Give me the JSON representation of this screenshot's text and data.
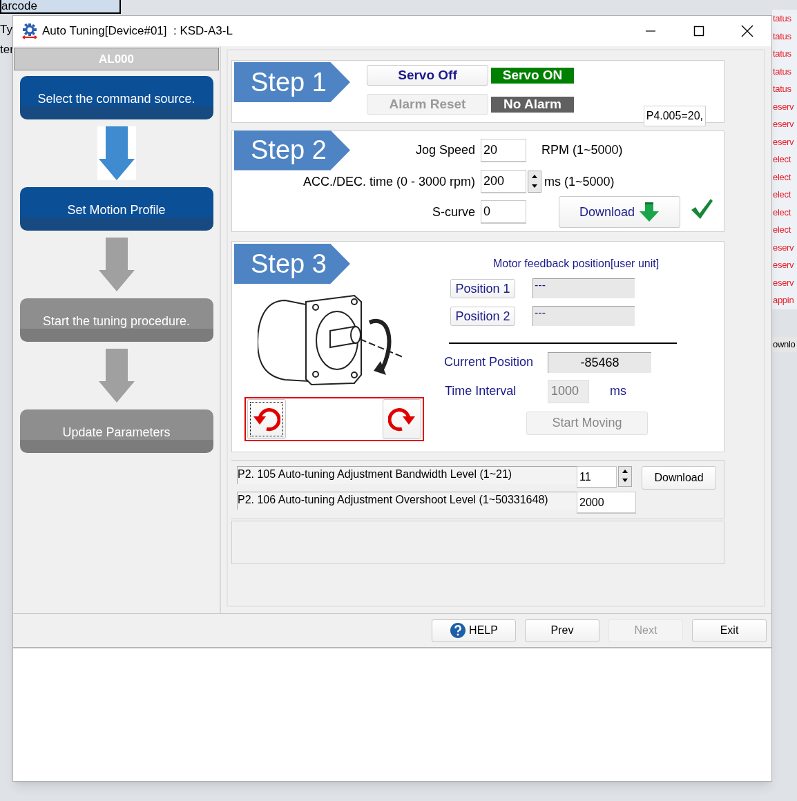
{
  "background_app": {
    "left_labels": [
      "arcode",
      "Ty",
      "ter"
    ],
    "right_column": [
      "tatus",
      "tatus",
      "tatus",
      "tatus",
      "tatus",
      "eserv",
      "eserv",
      "eserv",
      "elect",
      "elect",
      "elect",
      "elect",
      "elect",
      "eserv",
      "eserv",
      "eserv",
      "appin"
    ],
    "right_bottom": "ownlo"
  },
  "window": {
    "title": "Auto Tuning[Device#01]  : KSD-A3-L"
  },
  "alarm_code": "AL000",
  "steps": [
    {
      "label": "Select the command source.",
      "active": true
    },
    {
      "label": "Set Motion Profile",
      "active": true
    },
    {
      "label": "Start the tuning procedure.",
      "active": false
    },
    {
      "label": "Update Parameters",
      "active": false
    }
  ],
  "step1": {
    "badge": "Step 1",
    "buttons": [
      {
        "label": "Servo Off",
        "disabled": false
      },
      {
        "label": "Alarm Reset",
        "disabled": true
      }
    ],
    "indicators": [
      {
        "label": "Servo ON",
        "color": "#008000"
      },
      {
        "label": "No Alarm",
        "color": "#606060"
      }
    ],
    "param_field": "P4.005=20,"
  },
  "step2": {
    "badge": "Step 2",
    "fields": [
      {
        "label": "Jog Speed",
        "value": "20",
        "unit": "RPM (1~5000)",
        "spinner": false
      },
      {
        "label": "ACC./DEC. time (0 - 3000 rpm)",
        "value": "200",
        "unit": "ms (1~5000)",
        "spinner": true
      },
      {
        "label": "S-curve",
        "value": "0",
        "spinner": false
      }
    ],
    "download": "Download",
    "done": true
  },
  "step3": {
    "badge": "Step 3",
    "title": "Motor feedback position[user unit]",
    "positions": [
      {
        "label": "Position 1",
        "value": "---"
      },
      {
        "label": "Position 2",
        "value": "---"
      }
    ],
    "current_position": {
      "label": "Current Position",
      "value": "-85468"
    },
    "time_interval": {
      "label": "Time Interval",
      "value": "1000",
      "unit": "ms",
      "disabled": true
    },
    "start_moving": {
      "label": "Start Moving",
      "disabled": true
    },
    "rotate_buttons": [
      {
        "kind": "ccw",
        "focused": true
      },
      {
        "kind": "cw",
        "focused": false
      }
    ]
  },
  "parameters": [
    {
      "label": "P2. 105 Auto-tuning Adjustment Bandwidth Level (1~21)",
      "value": "11",
      "spinner": true,
      "button": "Download"
    },
    {
      "label": "P2. 106 Auto-tuning Adjustment Overshoot Level (1~50331648)",
      "value": "2000",
      "spinner": false
    }
  ],
  "footer": [
    {
      "label": "HELP",
      "kind": "help",
      "disabled": false
    },
    {
      "label": "Prev",
      "kind": "plain",
      "disabled": false
    },
    {
      "label": "Next",
      "kind": "plain",
      "disabled": true
    },
    {
      "label": "Exit",
      "kind": "plain",
      "disabled": false
    }
  ]
}
